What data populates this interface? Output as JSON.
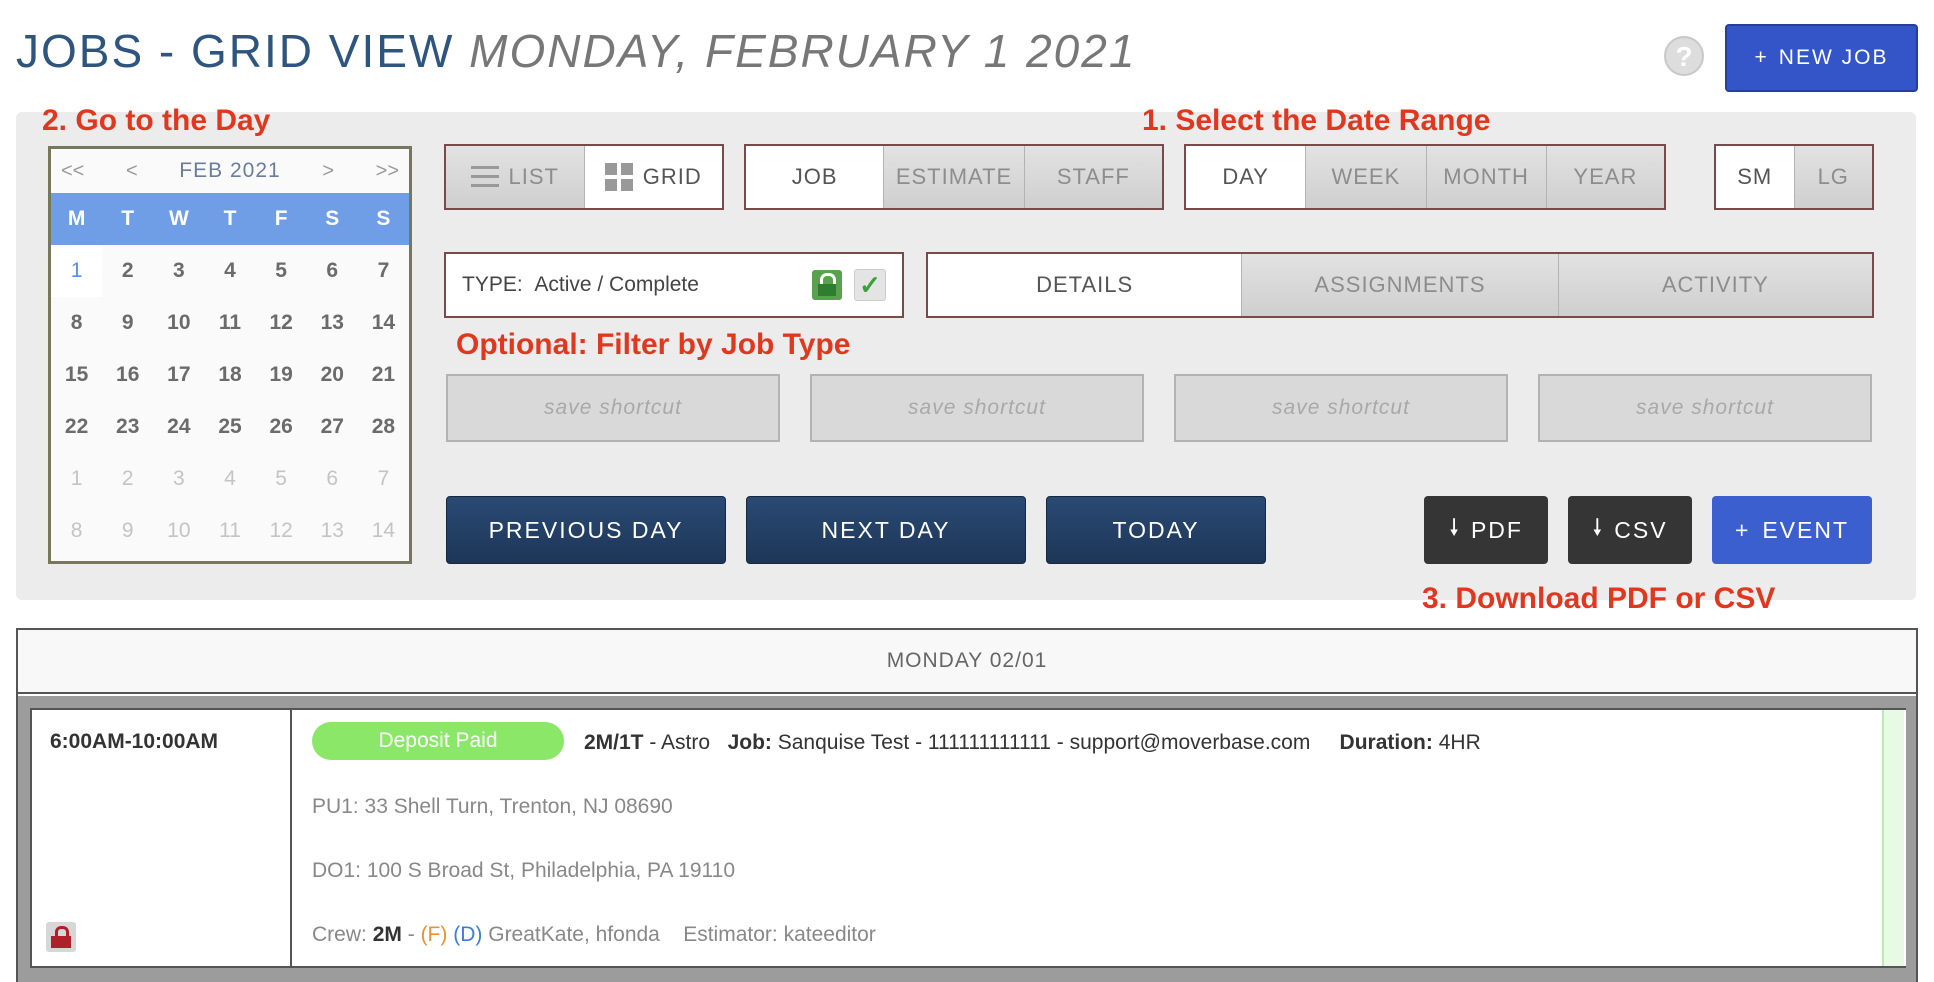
{
  "header": {
    "title": "JOBS - GRID VIEW",
    "date": "MONDAY, FEBRUARY 1 2021",
    "help_label": "?",
    "new_job_label": "NEW JOB",
    "new_job_icon": "+"
  },
  "annotations": {
    "goto_day": "2. Go to the Day",
    "select_range": "1. Select the Date Range",
    "filter_type": "Optional: Filter by Job Type",
    "download": "3. Download PDF or CSV"
  },
  "calendar": {
    "first": "<<",
    "prev": "<",
    "month": "FEB 2021",
    "next": ">",
    "last": ">>",
    "weekdays": [
      "M",
      "T",
      "W",
      "T",
      "F",
      "S",
      "S"
    ],
    "selected_day": "1",
    "weeks": [
      [
        "1",
        "2",
        "3",
        "4",
        "5",
        "6",
        "7"
      ],
      [
        "8",
        "9",
        "10",
        "11",
        "12",
        "13",
        "14"
      ],
      [
        "15",
        "16",
        "17",
        "18",
        "19",
        "20",
        "21"
      ],
      [
        "22",
        "23",
        "24",
        "25",
        "26",
        "27",
        "28"
      ],
      [
        "1",
        "2",
        "3",
        "4",
        "5",
        "6",
        "7"
      ],
      [
        "8",
        "9",
        "10",
        "11",
        "12",
        "13",
        "14"
      ]
    ]
  },
  "view_toggle": {
    "list": "LIST",
    "grid": "GRID",
    "active": "grid"
  },
  "category_toggle": {
    "job": "JOB",
    "estimate": "ESTIMATE",
    "staff": "STAFF",
    "active": "job"
  },
  "range_toggle": {
    "day": "DAY",
    "week": "WEEK",
    "month": "MONTH",
    "year": "YEAR",
    "active": "day"
  },
  "size_toggle": {
    "sm": "SM",
    "lg": "LG",
    "active": "sm"
  },
  "type_filter": {
    "label": "TYPE:",
    "value": "Active / Complete"
  },
  "detail_tabs": {
    "details": "DETAILS",
    "assignments": "ASSIGNMENTS",
    "activity": "ACTIVITY",
    "active": "details"
  },
  "shortcuts": [
    "save shortcut",
    "save shortcut",
    "save shortcut",
    "save shortcut"
  ],
  "nav_buttons": {
    "previous": "PREVIOUS DAY",
    "next": "NEXT DAY",
    "today": "TODAY"
  },
  "export_buttons": {
    "pdf": "PDF",
    "csv": "CSV",
    "event": "EVENT",
    "download_icon": "🠗",
    "plus_icon": "+"
  },
  "day": {
    "heading": "MONDAY 02/01",
    "job": {
      "time": "6:00AM-10:00AM",
      "status": "Deposit Paid",
      "status_color": "#8be768",
      "crew_code": "2M/1T",
      "truck": "- Astro",
      "job_label": "Job:",
      "job_text": "Sanquise Test - 111111111111 - support@moverbase.com",
      "duration_label": "Duration:",
      "duration": "4HR",
      "pickup": "PU1: 33 Shell Turn, Trenton, NJ 08690",
      "dropoff": "DO1: 100 S Broad St, Philadelphia, PA 19110",
      "crew_label": "Crew:",
      "crew_size": "2M",
      "crew_dash": "-",
      "foreman_tag": "(F)",
      "driver_tag": "(D)",
      "crew_names": "GreatKate, hfonda",
      "estimator_label": "Estimator:",
      "estimator": "kateeditor"
    }
  }
}
